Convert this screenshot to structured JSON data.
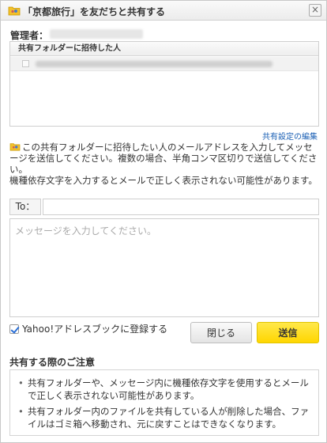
{
  "dialog": {
    "title": "「京都旅行」を友だちと共有する",
    "close_glyph": "×"
  },
  "manager": {
    "label": "管理者："
  },
  "invite_list": {
    "header": "共有フォルダーに招待した人"
  },
  "share_settings_link": "共有設定の編集",
  "notice": {
    "line1": "この共有フォルダーに招待したい人のメールアドレスを入力してメッセージを送信してください。複数の場合、半角コンマ区切りで送信してください。",
    "line2": "機種依存文字を入力するとメールで正しく表示されない可能性があります。"
  },
  "to_field": {
    "label": "To：",
    "value": ""
  },
  "message_field": {
    "placeholder": "メッセージを入力してください。",
    "value": ""
  },
  "yahoo_addressbook": {
    "label": "Yahoo!アドレスブックに登録する",
    "checked": true
  },
  "buttons": {
    "close_label": "閉じる",
    "send_label": "送信"
  },
  "caution": {
    "title": "共有する際のご注意",
    "items": [
      "共有フォルダーや、メッセージ内に機種依存文字を使用するとメールで正しく表示されない可能性があります。",
      "共有フォルダー内のファイルを共有している人が削除した場合、ファイルはゴミ箱へ移動され、元に戻すことはできなくなります。"
    ]
  },
  "colors": {
    "link": "#1a5fb4",
    "send_button": "#ffd600",
    "folder_icon": "#f0b400"
  },
  "icons": {
    "title": "shared-folder-icon",
    "notice": "shared-folder-icon",
    "close": "close-icon",
    "checkbox": "checkbox-checked-icon"
  }
}
